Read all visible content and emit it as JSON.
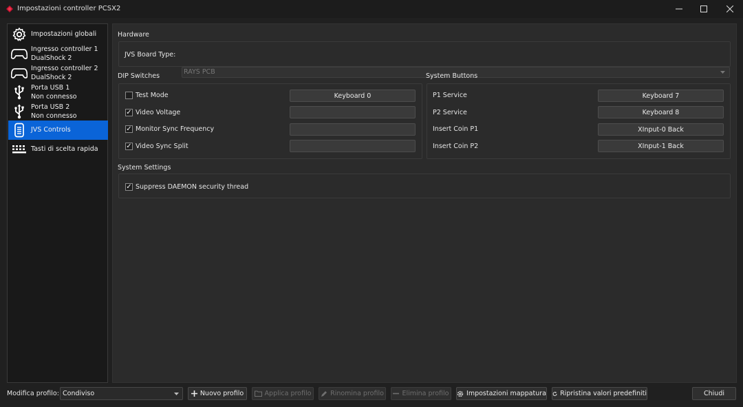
{
  "window": {
    "title": "Impostazioni controller PCSX2"
  },
  "sidebar": {
    "items": [
      {
        "line1": "Impostazioni globali",
        "line2": "",
        "icon": "gear-icon"
      },
      {
        "line1": "Ingresso controller 1",
        "line2": "DualShock 2",
        "icon": "gamepad-icon"
      },
      {
        "line1": "Ingresso controller 2",
        "line2": "DualShock 2",
        "icon": "gamepad-icon"
      },
      {
        "line1": "Porta USB 1",
        "line2": "Non connesso",
        "icon": "usb-icon"
      },
      {
        "line1": "Porta USB 2",
        "line2": "Non connesso",
        "icon": "usb-icon"
      },
      {
        "line1": "JVS Controls",
        "line2": "",
        "icon": "arcade-icon",
        "active": true
      },
      {
        "line1": "Tasti di scelta rapida",
        "line2": "",
        "icon": "keyboard-icon"
      }
    ]
  },
  "hardware": {
    "group_label": "Hardware",
    "board_type_label": "JVS Board Type:",
    "board_type_value": "RAYS PCB"
  },
  "dip": {
    "group_label": "DIP Switches",
    "rows": [
      {
        "label": "Test Mode",
        "checked": false,
        "binding": "Keyboard 0"
      },
      {
        "label": "Video Voltage",
        "checked": true,
        "binding": ""
      },
      {
        "label": "Monitor Sync Frequency",
        "checked": true,
        "binding": ""
      },
      {
        "label": "Video Sync Split",
        "checked": true,
        "binding": ""
      }
    ]
  },
  "system_buttons": {
    "group_label": "System Buttons",
    "rows": [
      {
        "label": "P1 Service",
        "binding": "Keyboard 7"
      },
      {
        "label": "P2 Service",
        "binding": "Keyboard 8"
      },
      {
        "label": "Insert Coin P1",
        "binding": "XInput-0 Back"
      },
      {
        "label": "Insert Coin P2",
        "binding": "XInput-1 Back"
      }
    ]
  },
  "system_settings": {
    "group_label": "System Settings",
    "suppress_label": "Suppress DAEMON security thread",
    "suppress_checked": true
  },
  "bottom": {
    "profile_label": "Modifica profilo:",
    "profile_value": "Condiviso",
    "new_profile": "Nuovo profilo",
    "apply_profile": "Applica profilo",
    "rename_profile": "Rinomina profilo",
    "delete_profile": "Elimina profilo",
    "mapping_settings": "Impostazioni mappatura",
    "restore_defaults": "Ripristina valori predefiniti",
    "close": "Chiudi"
  },
  "colors": {
    "accent": "#0a64d8",
    "background": "#2b2b2b",
    "sidebar": "#191919"
  }
}
